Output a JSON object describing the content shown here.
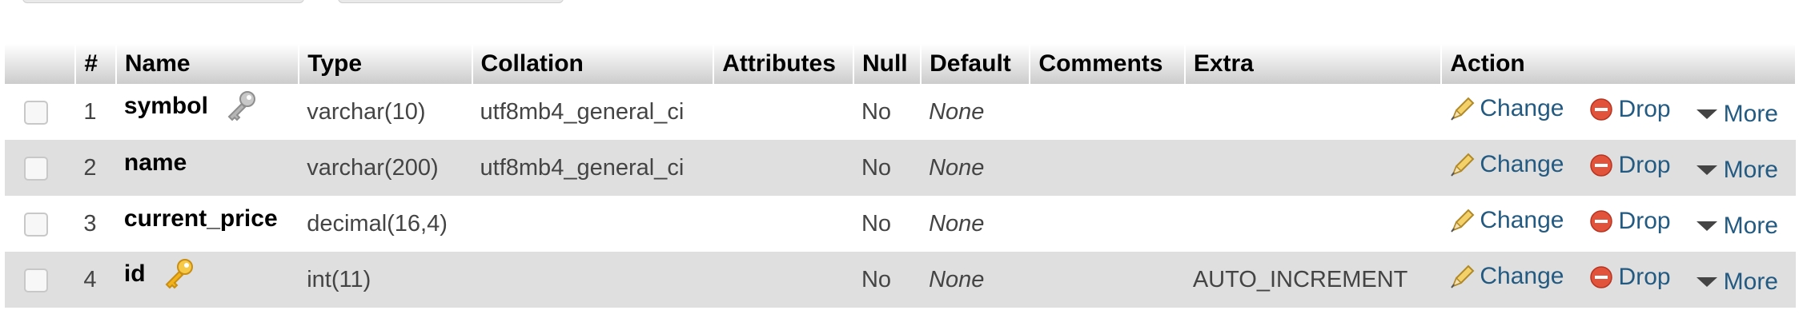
{
  "columns": {
    "num": "#",
    "name": "Name",
    "type": "Type",
    "collation": "Collation",
    "attributes": "Attributes",
    "null": "Null",
    "default": "Default",
    "comments": "Comments",
    "extra": "Extra",
    "action": "Action"
  },
  "actions": {
    "change": "Change",
    "drop": "Drop",
    "more": "More"
  },
  "rows": [
    {
      "num": "1",
      "name": "symbol",
      "key": "index",
      "type": "varchar(10)",
      "collation": "utf8mb4_general_ci",
      "attributes": "",
      "null": "No",
      "default": "None",
      "comments": "",
      "extra": ""
    },
    {
      "num": "2",
      "name": "name",
      "key": "",
      "type": "varchar(200)",
      "collation": "utf8mb4_general_ci",
      "attributes": "",
      "null": "No",
      "default": "None",
      "comments": "",
      "extra": ""
    },
    {
      "num": "3",
      "name": "current_price",
      "key": "",
      "type": "decimal(16,4)",
      "collation": "",
      "attributes": "",
      "null": "No",
      "default": "None",
      "comments": "",
      "extra": ""
    },
    {
      "num": "4",
      "name": "id",
      "key": "primary",
      "type": "int(11)",
      "collation": "",
      "attributes": "",
      "null": "No",
      "default": "None",
      "comments": "",
      "extra": "AUTO_INCREMENT"
    }
  ],
  "colors": {
    "link": "#235a81",
    "row_alt": "#dfdfdf",
    "primary_key": "#f2b21b",
    "index_key": "#a8a8a8",
    "drop_icon": "#e2533b"
  }
}
